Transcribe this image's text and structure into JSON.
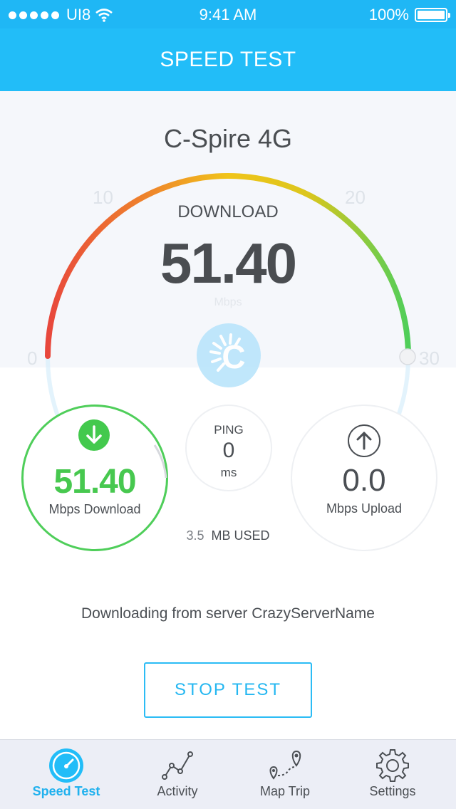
{
  "status_bar": {
    "carrier": "UI8",
    "time": "9:41 AM",
    "battery": "100%"
  },
  "header": {
    "title": "SPEED TEST"
  },
  "network": {
    "name": "C-Spire 4G"
  },
  "gauge": {
    "label": "DOWNLOAD",
    "value": "51.40",
    "unit": "Mbps",
    "ticks": [
      "0",
      "10",
      "20",
      "30"
    ],
    "logo_letter": "C",
    "colors": {
      "low": "#e8473c",
      "mid": "#f0c419",
      "high": "#4fce5a"
    }
  },
  "download": {
    "value": "51.40",
    "label": "Mbps Download"
  },
  "ping": {
    "title": "PING",
    "value": "0",
    "unit": "ms"
  },
  "data_used": {
    "value": "3.5",
    "label": "MB USED"
  },
  "upload": {
    "value": "0.0",
    "label": "Mbps Upload"
  },
  "server": {
    "text": "Downloading from server CrazyServerName"
  },
  "actions": {
    "stop_label": "STOP TEST"
  },
  "tabs": [
    {
      "label": "Speed Test",
      "icon": "speedometer-icon",
      "active": true
    },
    {
      "label": "Activity",
      "icon": "activity-chart-icon",
      "active": false
    },
    {
      "label": "Map Trip",
      "icon": "map-trip-icon",
      "active": false
    },
    {
      "label": "Settings",
      "icon": "gear-icon",
      "active": false
    }
  ],
  "accent_color": "#22bdf8"
}
